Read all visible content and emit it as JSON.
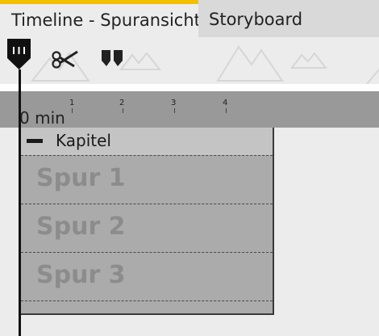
{
  "tabs": [
    {
      "label": "Timeline - Spuransicht",
      "active": true
    },
    {
      "label": "Storyboard",
      "active": false
    }
  ],
  "accent_color": "#f2c000",
  "toolbar": {
    "playhead_icon": "playhead-marker-icon",
    "cut_icon": "scissors-icon",
    "marker_icon": "split-marker-icon"
  },
  "ruler": {
    "start_label": "0 min",
    "ticks": [
      "1",
      "2",
      "3",
      "4"
    ]
  },
  "chapter": {
    "label": "Kapitel",
    "tracks": [
      "Spur 1",
      "Spur 2",
      "Spur 3"
    ]
  }
}
